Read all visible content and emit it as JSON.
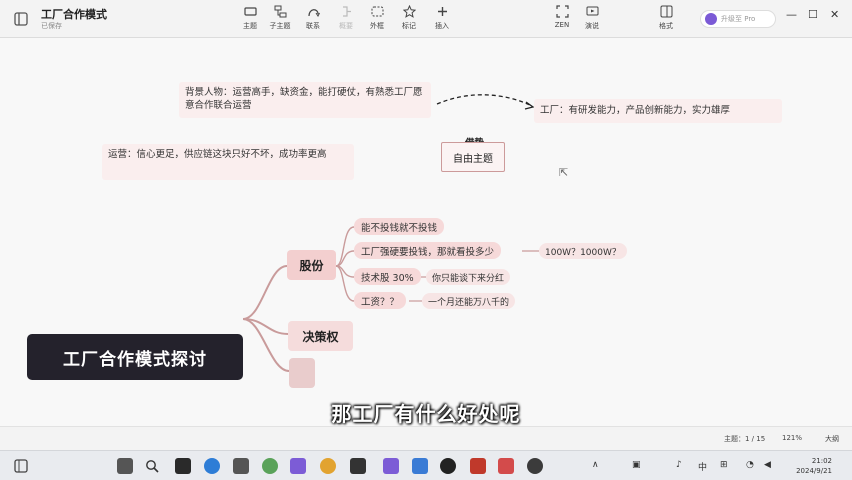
{
  "app": {
    "title": "工厂合作模式",
    "subtitle": "已保存"
  },
  "toolbar": [
    {
      "label": "主题",
      "icon": "topic-icon"
    },
    {
      "label": "子主题",
      "icon": "subtopic-icon"
    },
    {
      "label": "联系",
      "icon": "relation-icon"
    },
    {
      "label": "概要",
      "icon": "summary-icon",
      "disabled": true
    },
    {
      "label": "外框",
      "icon": "boundary-icon"
    },
    {
      "label": "标记",
      "icon": "marker-icon"
    },
    {
      "label": "插入",
      "icon": "insert-icon"
    },
    {
      "label": "ZEN",
      "icon": "zen-icon"
    },
    {
      "label": "演说",
      "icon": "pitch-icon"
    },
    {
      "label": "格式",
      "icon": "format-icon"
    }
  ],
  "account": {
    "label": "升级至 Pro"
  },
  "canvas": {
    "background_person": "背景人物：运营高手，缺资金，能打硬仗，有熟悉工厂愿意合作联合运营",
    "leverage_label": "借势",
    "factory_note": "工厂：有研发能力，产品创新能力，实力雄厚",
    "operation_note": "运营：信心更足，供应链这块只好不坏，成功率更高",
    "free_topic": "自由主题",
    "root": "工厂合作模式探讨",
    "branches": [
      {
        "label": "股份",
        "children": [
          {
            "label": "能不投钱就不投钱"
          },
          {
            "label": "工厂强硬要投钱，那就看投多少",
            "leaf": "100W？1000W？"
          },
          {
            "label": "技术股 30%",
            "leaf": "你只能谈下来分红"
          },
          {
            "label": "工资？？",
            "leaf": "一个月还能万八千的"
          }
        ]
      },
      {
        "label": "决策权",
        "children": []
      },
      {
        "label": "",
        "children": []
      }
    ]
  },
  "subtitle": "那工厂有什么好处呢",
  "status": {
    "topics": "主题：1 / 15",
    "zoom": "121%",
    "size_label": "大纲"
  },
  "clock": {
    "time": "21:02",
    "date": "2024/9/21"
  },
  "tray": {
    "lang": "中"
  },
  "colors": {
    "root_bg": "#24222c",
    "main_node": "#f3cfcf",
    "sub_node": "#f6d9d9",
    "connector": "#c99b9b",
    "accent": "#7b5ad6"
  }
}
